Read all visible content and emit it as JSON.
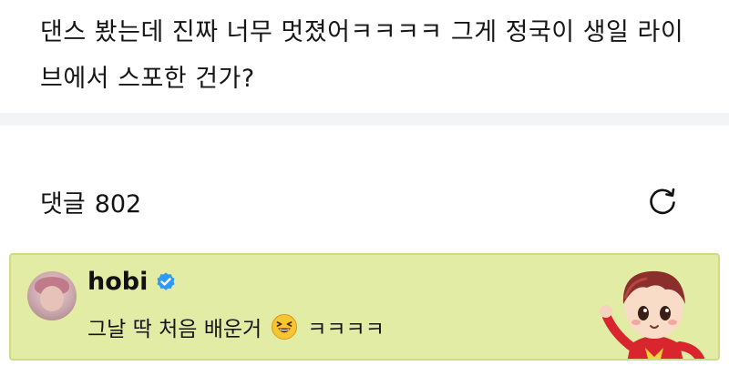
{
  "post": {
    "text": "댄스 봤는데 진짜 너무 멋졌어ㅋㅋㅋㅋ 그게 정국이 생일 라이브에서 스포한 건가?"
  },
  "comments": {
    "label": "댓글",
    "count": "802",
    "refresh_icon": "refresh-icon"
  },
  "pinned_comment": {
    "author": "hobi",
    "verified_icon": "verified-badge-icon",
    "text_before": "그날 딱 처음 배운거",
    "emoji_icon": "laughing-emoji-icon",
    "text_after": "ㅋㅋㅋㅋ",
    "sticker_icon": "character-sticker-icon",
    "colors": {
      "background": "#e3eca5",
      "border": "#cfdc85",
      "verified": "#2f9bf0"
    }
  }
}
